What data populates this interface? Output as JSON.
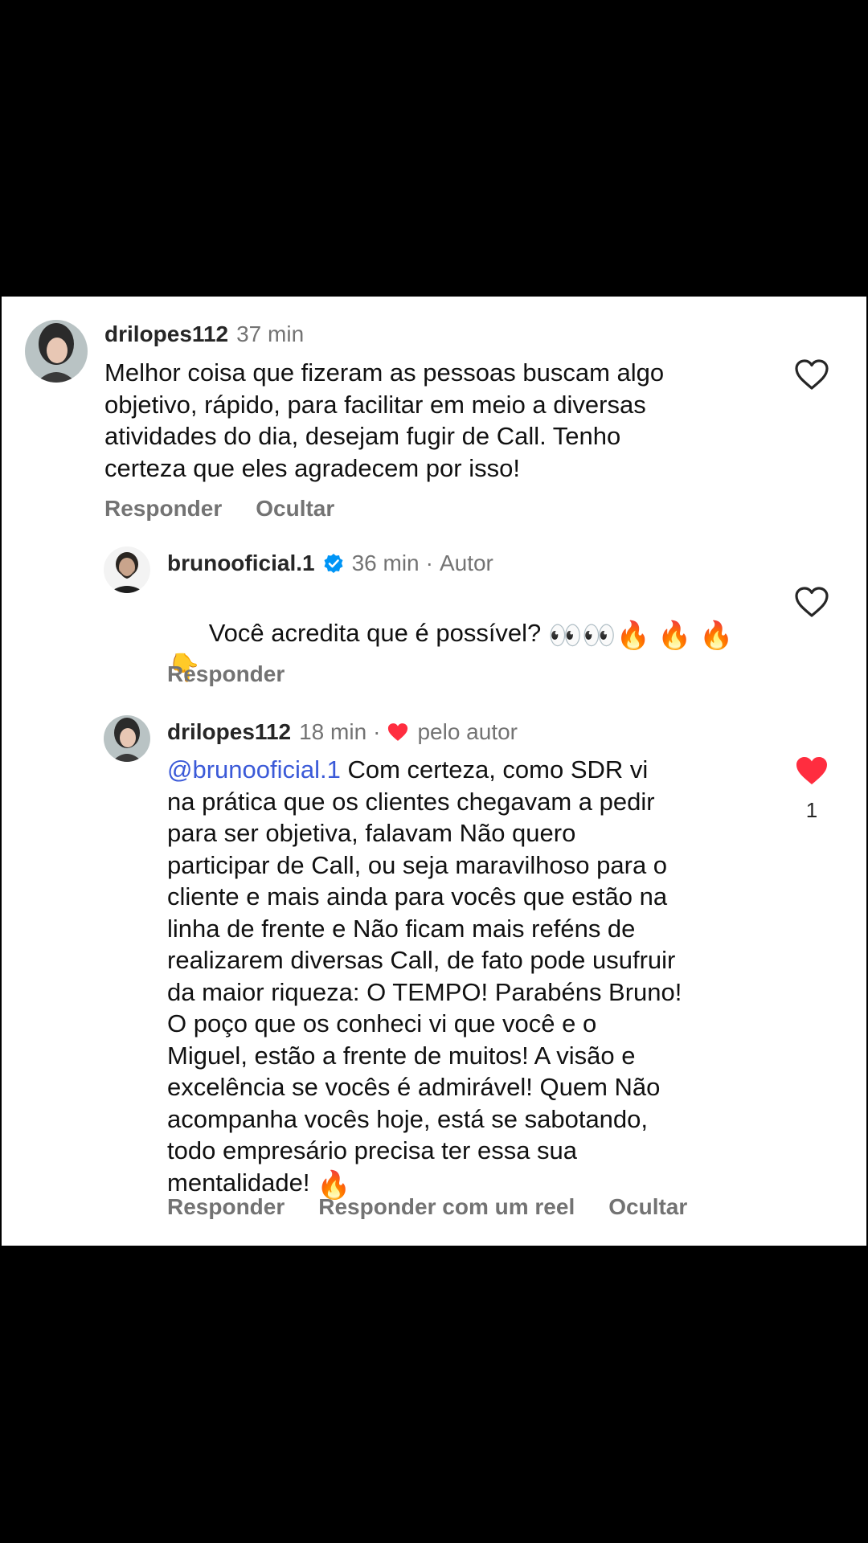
{
  "comments": [
    {
      "username": "drilopes112",
      "time": "37 min",
      "text": "Melhor coisa que fizeram as pessoas buscam algo\nobjetivo, rápido, para facilitar em meio a diversas\natividades do dia, desejam fugir de Call. Tenho\ncerteza que eles agradecem por isso!",
      "actions": [
        "Responder",
        "Ocultar"
      ],
      "liked": false
    },
    {
      "username": "brunooficial.1",
      "verified": true,
      "time": "36 min",
      "separator": "·",
      "badge": "Autor",
      "text_line1": "Você acredita que é possível?",
      "emojis_line1": "👀👀🔥 🔥 🔥",
      "emojis_line2": "👇",
      "actions": [
        "Responder"
      ],
      "liked": false
    },
    {
      "username": "drilopes112",
      "time": "18 min",
      "separator": "·",
      "liked_by_label": "pelo autor",
      "mention": "@brunooficial.1",
      "text_first": " Com certeza, como SDR vi\nna prática que os clientes chegavam a pedir\npara ser objetiva, falavam Não quero\nparticipar de Call, ou seja maravilhoso para o\ncliente e mais ainda para vocês que estão na\nlinha de frente e Não ficam mais reféns de\nrealizarem diversas Call, de fato pode usufruir\nda maior riqueza: O TEMPO! Parabéns Bruno!\nO poço que os conheci vi que você e o\nMiguel, estão a frente de muitos! A visão e\nexcelência se vocês é admirável! Quem Não\nacompanha vocês hoje, está se sabotando,\ntodo empresário precisa ter essa sua\nmentalidade! ",
      "text_emoji": "🔥",
      "actions": [
        "Responder",
        "Responder com um reel",
        "Ocultar"
      ],
      "liked": true,
      "like_count": "1"
    }
  ],
  "colors": {
    "background": "#000000",
    "panel": "#ffffff",
    "text": "#111111",
    "muted": "#737373",
    "mention": "#3b5ad8",
    "heart_red": "#ff2d3f",
    "verified_blue": "#0095f6"
  }
}
